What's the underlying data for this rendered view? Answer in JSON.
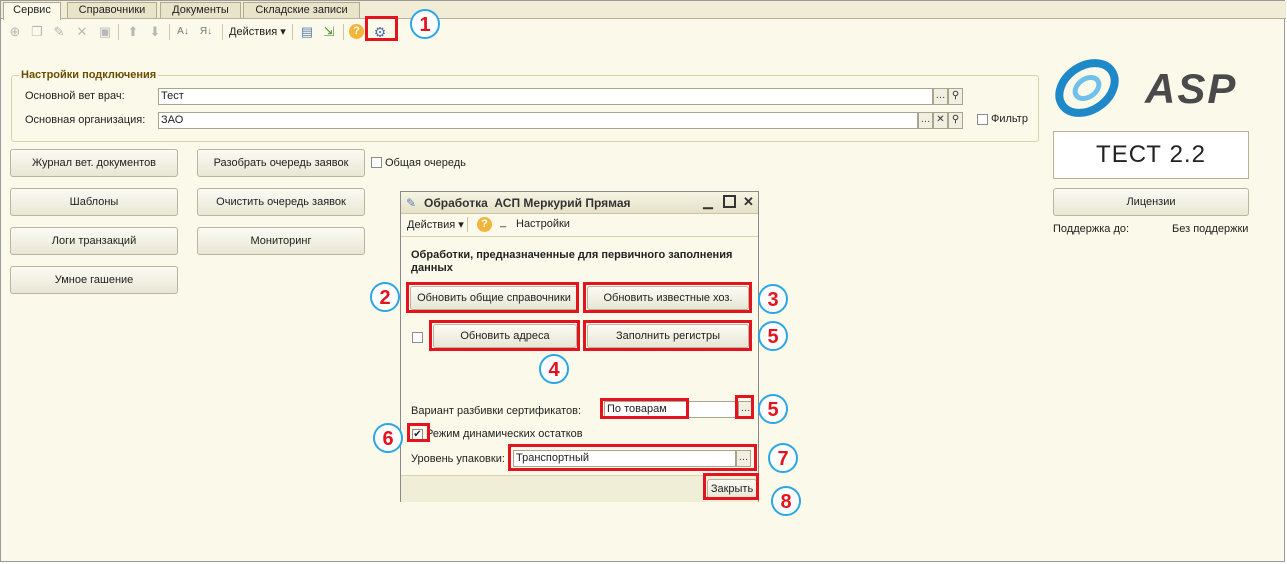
{
  "tabs": [
    "Сервис",
    "Справочники",
    "Документы",
    "Складские записи"
  ],
  "toolbar": {
    "actions_label": "Действия ▾",
    "icons": [
      "add-icon",
      "copy-icon",
      "edit-icon",
      "delete-icon",
      "save-icon",
      "move-up-icon",
      "move-down-icon",
      "sort-asc-icon",
      "sort-desc-icon",
      "help-icon",
      "settings-icon"
    ]
  },
  "connection": {
    "title": "Настройки подключения",
    "vet_label": "Основной вет врач:",
    "vet_value": "Тест",
    "org_label": "Основная организация:",
    "org_value": "ЗАО",
    "filter_label": "Фильтр"
  },
  "left_buttons": {
    "journal": "Журнал вет. документов",
    "templates": "Шаблоны",
    "logs": "Логи транзакций",
    "smart": "Умное гашение"
  },
  "mid_buttons": {
    "parse_queue": "Разобрать очередь заявок",
    "clear_queue": "Очистить очередь заявок",
    "monitoring": "Мониторинг",
    "common_queue": "Общая очередь"
  },
  "right_panel": {
    "logo_text": "ASP",
    "version": "ТЕСТ 2.2",
    "licenses": "Лицензии",
    "support_label": "Поддержка до:",
    "support_value": "Без поддержки"
  },
  "dialog": {
    "title": "Обработка  АСП Меркурий Прямая",
    "actions": "Действия ▾",
    "help": "?",
    "underscore": "_",
    "settings": "Настройки",
    "heading": "Обработки, предназначенные для первичного заполнения данных",
    "btn_refs": "Обновить общие справочники",
    "btn_known": "Обновить известные хоз.",
    "btn_addresses": "Обновить адреса",
    "btn_registers": "Заполнить регистры",
    "split_label": "Вариант разбивки сертификатов:",
    "split_value": "По товарам",
    "dynamic_label": "Режим динамических остатков",
    "dynamic_checked": true,
    "pack_label": "Уровень упаковки:",
    "pack_value": "Транспортный",
    "close": "Закрыть"
  },
  "markers": [
    "1",
    "2",
    "3",
    "4",
    "5",
    "5",
    "6",
    "7",
    "8"
  ],
  "colors": {
    "highlight": "#e5131d",
    "marker_border": "#2ba6e6",
    "logo_blue": "#1e88c8",
    "logo_gray": "#4a4a4a"
  }
}
